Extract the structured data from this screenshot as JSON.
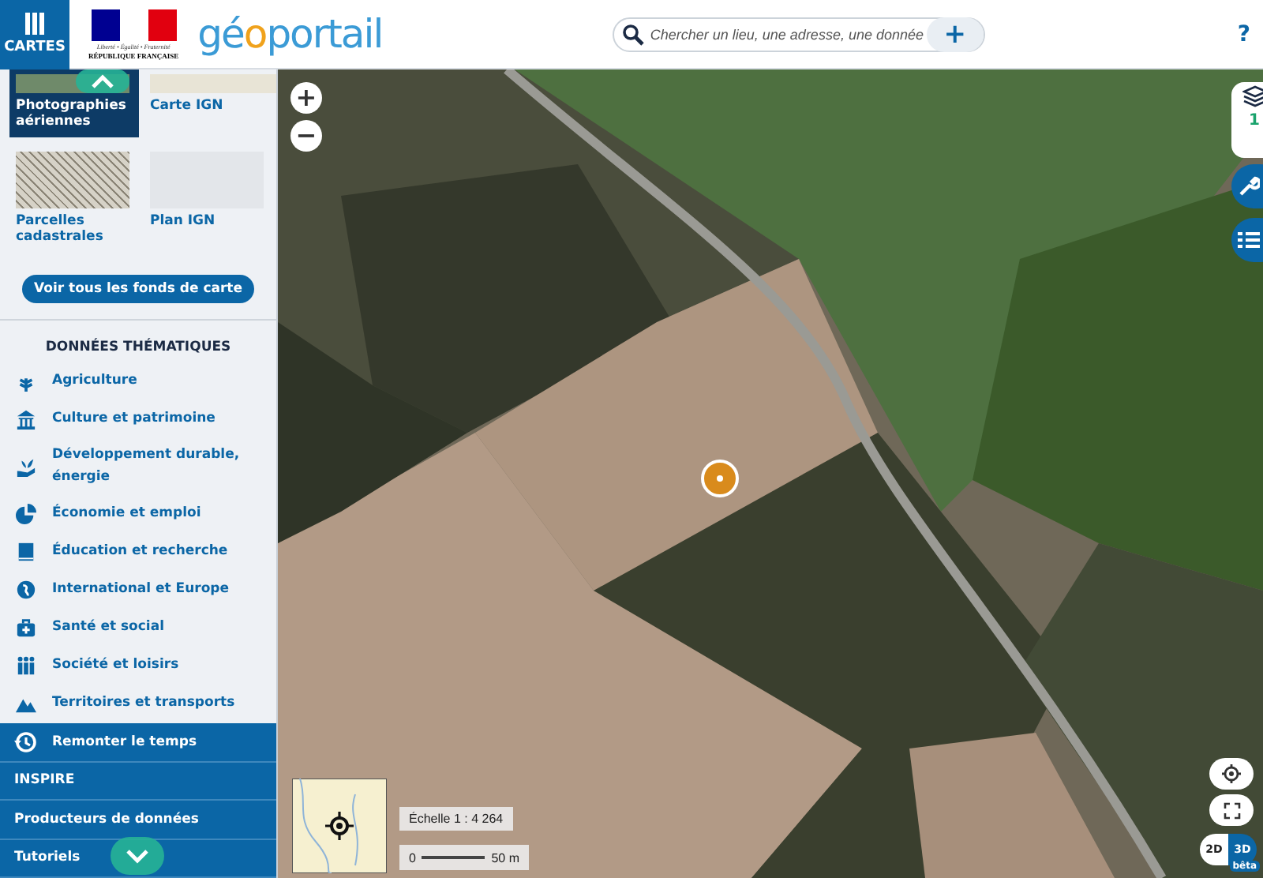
{
  "header": {
    "menu_button": "CARTES",
    "republic_logo": {
      "motto": "Liberté • Égalité • Fraternité",
      "name": "RÉPUBLIQUE FRANÇAISE"
    },
    "app_logo": [
      "gé",
      "o",
      "portail"
    ],
    "search": {
      "placeholder": "Chercher un lieu, une adresse, une donnée",
      "add_button": "+"
    },
    "help": "?"
  },
  "sidebar": {
    "base_maps": [
      {
        "label": "Photographies aériennes",
        "selected": true,
        "kind": "photo"
      },
      {
        "label": "Carte IGN",
        "selected": false,
        "kind": "map"
      },
      {
        "label": "Parcelles cadastrales",
        "selected": false,
        "kind": "cadastre"
      },
      {
        "label": "Plan IGN",
        "selected": false,
        "kind": "plan"
      }
    ],
    "all_maps_button": "Voir tous les fonds de carte",
    "themes_title": "DONNÉES THÉMATIQUES",
    "themes": [
      {
        "label": "Agriculture",
        "kind": "plant"
      },
      {
        "label": "Culture et patrimoine",
        "kind": "monument"
      },
      {
        "label": "Développement durable, énergie",
        "kind": "hand"
      },
      {
        "label": "Économie et emploi",
        "kind": "pie"
      },
      {
        "label": "Éducation et recherche",
        "kind": "book"
      },
      {
        "label": "International et Europe",
        "kind": "globe"
      },
      {
        "label": "Santé et social",
        "kind": "kit"
      },
      {
        "label": "Société et loisirs",
        "kind": "people"
      },
      {
        "label": "Territoires et transports",
        "kind": "mountain"
      }
    ],
    "footer_links": [
      {
        "label": "Remonter le temps",
        "kind": "history"
      },
      {
        "label": "INSPIRE",
        "kind": "plain"
      },
      {
        "label": "Producteurs de données",
        "kind": "plain"
      },
      {
        "label": "Tutoriels",
        "kind": "plain"
      }
    ]
  },
  "map": {
    "zoom_in": "+",
    "zoom_out": "−",
    "layers_count": "1",
    "scale": "Échelle 1 : 4 264",
    "scale_bar": {
      "start": "0",
      "end": "50 m"
    },
    "view_modes": [
      {
        "label": "2D",
        "selected": false
      },
      {
        "label": "3D",
        "selected": true
      }
    ],
    "beta_badge": "bêta"
  }
}
